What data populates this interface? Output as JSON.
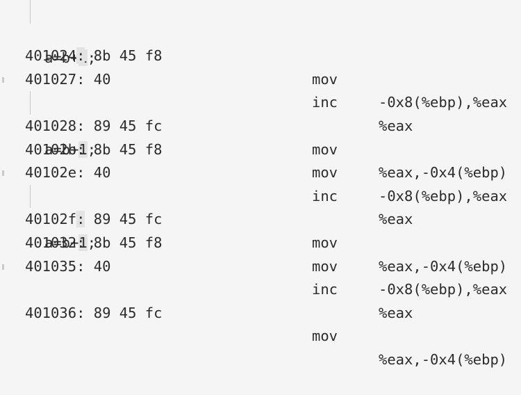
{
  "source_lines": [
    {
      "before": "a=b+",
      "highlight": "1",
      "after": ";"
    },
    {
      "before": "a=b+",
      "highlight": "1",
      "after": ";"
    },
    {
      "before": "a=b+",
      "highlight": "1",
      "after": ";"
    }
  ],
  "disasm_groups": [
    [
      {
        "address": "401024",
        "colon": ":",
        "bytes": " 8b 45 f8",
        "mnemonic": "mov",
        "operands": "-0x8(%ebp),%eax"
      },
      {
        "address": "401027",
        "colon": ":",
        "bytes": " 40",
        "mnemonic": "inc",
        "operands": "%eax"
      },
      {
        "address": "401028",
        "colon": ":",
        "bytes": " 89 45 fc",
        "mnemonic": "mov",
        "operands": "%eax,-0x4(%ebp)"
      }
    ],
    [
      {
        "address": "40102b",
        "colon": ":",
        "bytes": " 8b 45 f8",
        "mnemonic": "mov",
        "operands": "-0x8(%ebp),%eax"
      },
      {
        "address": "40102e",
        "colon": ":",
        "bytes": " 40",
        "mnemonic": "inc",
        "operands": "%eax"
      },
      {
        "address": "40102f",
        "colon": ":",
        "bytes": " 89 45 fc",
        "mnemonic": "mov",
        "operands": "%eax,-0x4(%ebp)"
      }
    ],
    [
      {
        "address": "401032",
        "colon": ":",
        "bytes": " 8b 45 f8",
        "mnemonic": "mov",
        "operands": "-0x8(%ebp),%eax"
      },
      {
        "address": "401035",
        "colon": ":",
        "bytes": " 40",
        "mnemonic": "inc",
        "operands": "%eax"
      },
      {
        "address": "401036",
        "colon": ":",
        "bytes": " 89 45 fc",
        "mnemonic": "mov",
        "operands": "%eax,-0x4(%ebp)"
      }
    ]
  ]
}
